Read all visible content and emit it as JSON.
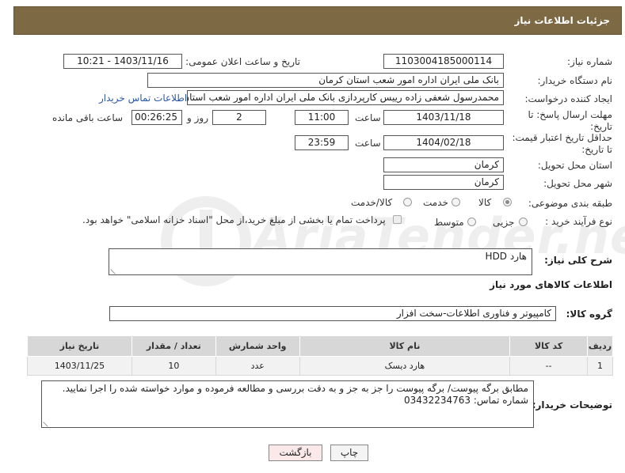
{
  "header": {
    "title": "جزئیات اطلاعات نیاز"
  },
  "form": {
    "need_number_label": "شماره نیاز:",
    "need_number": "1103004185000114",
    "announce_label": "تاریخ و ساعت اعلان عمومی:",
    "announce_value": "1403/11/16 - 10:21",
    "buyer_org_label": "نام دستگاه خریدار:",
    "buyer_org": "بانک ملی ایران اداره امور شعب استان کرمان",
    "requester_label": "ایجاد کننده درخواست:",
    "requester": "محمدرسول شعفی زاده رییس کارپردازی بانک ملی ایران اداره امور شعب استان",
    "contact_link": "اطلاعات تماس خریدار",
    "reply_deadline_label": "مهلت ارسال پاسخ: تا تاریخ:",
    "reply_date": "1403/11/18",
    "time_label": "ساعت",
    "reply_time": "11:00",
    "days_value": "2",
    "days_label": "روز و",
    "remaining_time": "00:26:25",
    "remaining_label": "ساعت باقی مانده",
    "price_deadline_label": "حداقل تاریخ اعتبار قیمت: تا تاریخ:",
    "price_date": "1404/02/18",
    "price_time": "23:59",
    "province_label": "استان محل تحویل:",
    "province": "کرمان",
    "city_label": "شهر محل تحویل:",
    "city": "کرمان",
    "category_label": "طبقه بندی موضوعی:",
    "category_options": [
      "کالا",
      "خدمت",
      "کالا/خدمت"
    ],
    "process_label": "نوع فرآیند خرید :",
    "process_options": [
      "جزیی",
      "متوسط"
    ],
    "payment_note": "پرداخت تمام یا بخشی از مبلغ خرید،از محل \"اسناد خزانه اسلامی\" خواهد بود."
  },
  "description": {
    "label": "شرح کلی نیاز:",
    "value": "هارد HDD"
  },
  "goods_section_title": "اطلاعات کالاهای مورد نیاز",
  "goods_group": {
    "label": "گروه کالا:",
    "value": "کامپیوتر و فناوری اطلاعات-سخت افزار"
  },
  "table": {
    "headers": [
      "ردیف",
      "کد کالا",
      "نام کالا",
      "واحد شمارش",
      "تعداد / مقدار",
      "تاریخ نیاز"
    ],
    "rows": [
      [
        "1",
        "--",
        "هارد دیسک",
        "عدد",
        "10",
        "1403/11/25"
      ]
    ]
  },
  "buyer_notes": {
    "label": "توضیحات خریدار:",
    "line1": "مطابق برگه پیوست/ برگه پیوست را جز به جز و به دقت بررسی و مطالعه فرموده و موارد خواسته شده را اجرا نمایید.",
    "line2": "شماره تماس: 03432234763"
  },
  "buttons": {
    "print": "چاپ",
    "back": "بازگشت"
  },
  "watermark": {
    "text": "AriaTender.neT"
  },
  "colors": {
    "header_bg": "#7d6a44",
    "link": "#2a58a8",
    "table_header": "#d7d7d7"
  }
}
